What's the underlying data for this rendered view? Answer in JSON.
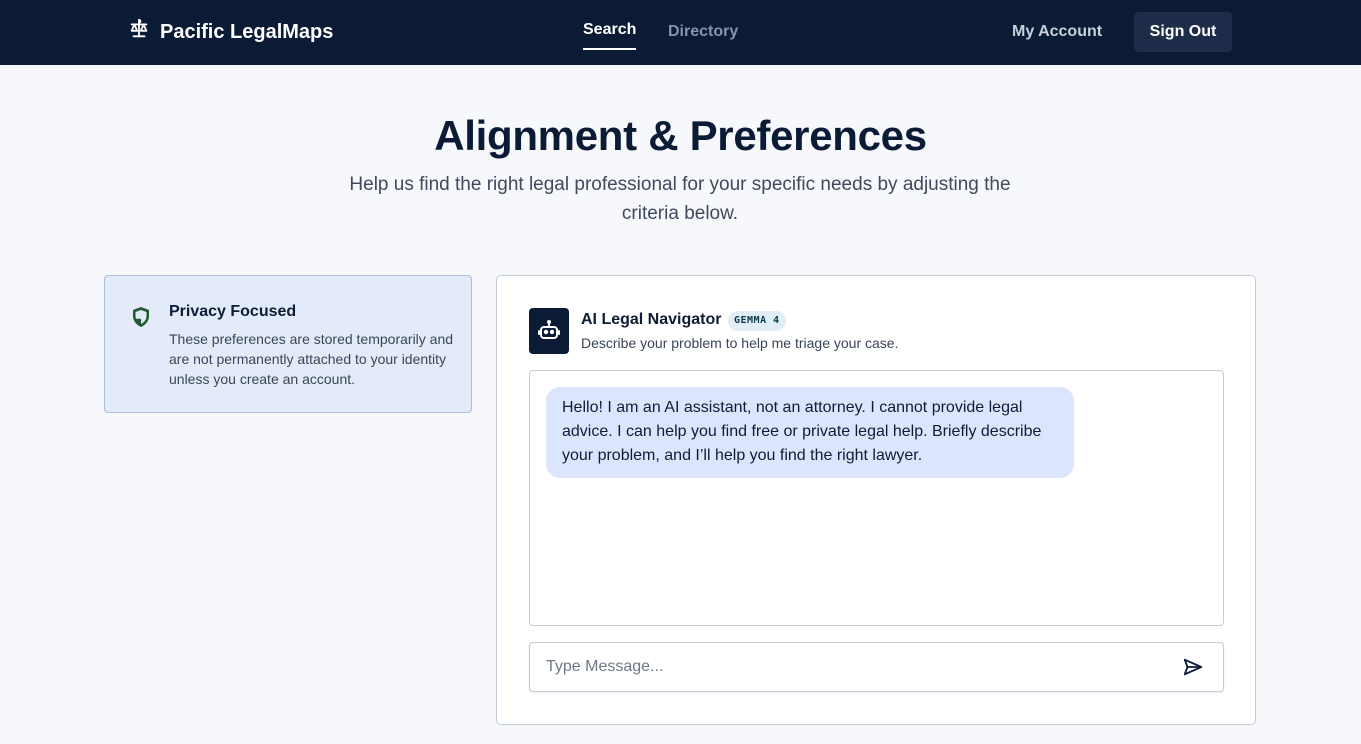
{
  "nav": {
    "brand": "Pacific LegalMaps",
    "links": [
      {
        "label": "Search",
        "active": true
      },
      {
        "label": "Directory",
        "active": false
      }
    ],
    "account_label": "My Account",
    "signout_label": "Sign Out"
  },
  "hero": {
    "title": "Alignment & Preferences",
    "subtitle": "Help us find the right legal professional for your specific needs by adjusting the criteria below."
  },
  "privacy": {
    "icon": "shield-icon",
    "title": "Privacy Focused",
    "text": "These preferences are stored temporarily and are not permanently attached to your identity unless you create an account."
  },
  "assistant": {
    "icon": "robot-icon",
    "name": "AI Legal Navigator",
    "model_badge": "GEMMA 4",
    "description": "Describe your problem to help me triage your case.",
    "messages": [
      {
        "role": "assistant",
        "text": "Hello! I am an AI assistant, not an attorney. I cannot provide legal advice. I can help you find free or private legal help. Briefly describe your problem, and I’ll help you find the right lawyer."
      }
    ],
    "input_placeholder": "Type Message...",
    "send_icon": "send-icon"
  },
  "colors": {
    "navbar": "#0b1b36",
    "accent_bubble": "#dbe6fc",
    "privacy_card": "#e3ebfa",
    "shield_green": "#1e5b2e"
  }
}
